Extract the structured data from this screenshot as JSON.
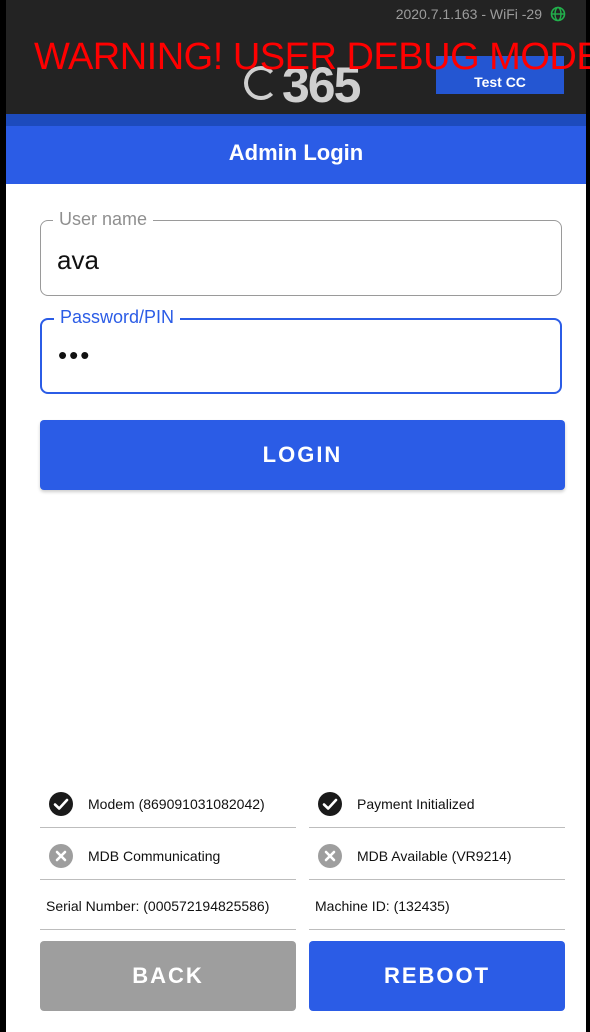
{
  "status_bar": {
    "version_wifi": "2020.7.1.163 - WiFi -29",
    "globe_icon": "globe-icon",
    "globe_color": "#22b14c"
  },
  "header": {
    "logo_text": "365",
    "site_button_label": "Test CC",
    "warning": "WARNING! USER DEBUG MODE",
    "warning_color": "#ff0000"
  },
  "title": "Admin Login",
  "form": {
    "username": {
      "label": "User name",
      "value": "ava"
    },
    "password": {
      "label": "Password/PIN",
      "value": "•••"
    },
    "login_label": "LOGIN"
  },
  "status": {
    "modem": {
      "label": "Modem (869091031082042)",
      "state": "ok",
      "icon": "check-circle-icon"
    },
    "payment": {
      "label": "Payment Initialized",
      "state": "ok",
      "icon": "check-circle-icon"
    },
    "mdb_comm": {
      "label": "MDB Communicating",
      "state": "error",
      "icon": "x-circle-icon"
    },
    "mdb_avail": {
      "label": "MDB Available (VR9214)",
      "state": "error",
      "icon": "x-circle-icon"
    },
    "serial": "Serial Number: (000572194825586)",
    "machine_id": "Machine ID: (132435)"
  },
  "buttons": {
    "back": "BACK",
    "reboot": "REBOOT"
  },
  "colors": {
    "primary": "#2b5ce6",
    "disabled": "#9e9e9e",
    "header_bg": "#232323"
  }
}
